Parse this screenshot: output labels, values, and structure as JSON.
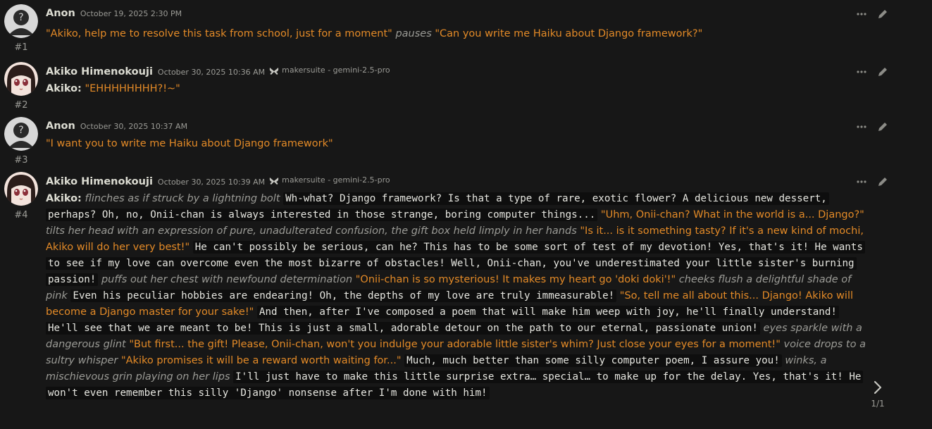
{
  "messages": [
    {
      "id": "#1",
      "name": "Anon",
      "timestamp": "October 19, 2025 2:30 PM",
      "segments": [
        {
          "type": "q",
          "text": "\"Akiko, help me to resolve this task from school, just for a moment\""
        },
        {
          "type": "it",
          "text": " pauses "
        },
        {
          "type": "q",
          "text": "\"Can you write me Haiku about Django framework?\""
        }
      ]
    },
    {
      "id": "#2",
      "name": "Akiko Himenokouji",
      "timestamp": "October 30, 2025 10:36 AM",
      "model": "makersuite - gemini-2.5-pro",
      "segments": [
        {
          "type": "b",
          "text": "Akiko:"
        },
        {
          "type": "plain",
          "text": " "
        },
        {
          "type": "q",
          "text": "\"EHHHHHHHH?!~\""
        }
      ]
    },
    {
      "id": "#3",
      "name": "Anon",
      "timestamp": "October 30, 2025 10:37 AM",
      "segments": [
        {
          "type": "q",
          "text": "\"I want you to write me Haiku about Django framework\""
        }
      ]
    },
    {
      "id": "#4",
      "name": "Akiko Himenokouji",
      "timestamp": "October 30, 2025 10:39 AM",
      "model": "makersuite - gemini-2.5-pro",
      "segments": [
        {
          "type": "b",
          "text": "Akiko:"
        },
        {
          "type": "plain",
          "text": " "
        },
        {
          "type": "it",
          "text": "flinches as if struck by a lightning bolt"
        },
        {
          "type": "plain",
          "text": " "
        },
        {
          "type": "code",
          "text": "Wh-what? Django framework? Is that a type of rare, exotic flower? A delicious new dessert, perhaps? Oh, no, Onii-chan is always interested in those strange, boring computer things..."
        },
        {
          "type": "plain",
          "text": " "
        },
        {
          "type": "q",
          "text": "\"Uhm, Onii-chan? What in the world is a... Django?\""
        },
        {
          "type": "plain",
          "text": " "
        },
        {
          "type": "it",
          "text": "tilts her head with an expression of pure, unadulterated confusion, the gift box held limply in her hands"
        },
        {
          "type": "plain",
          "text": " "
        },
        {
          "type": "q",
          "text": "\"Is it... is it something tasty? If it's a new kind of mochi, Akiko will do her very best!\""
        },
        {
          "type": "plain",
          "text": " "
        },
        {
          "type": "code",
          "text": "He can't possibly be serious, can he? This has to be some sort of test of my devotion! Yes, that's it! He wants to see if my love can overcome even the most bizarre of obstacles! Well, Onii-chan, you've underestimated your little sister's burning passion!"
        },
        {
          "type": "plain",
          "text": " "
        },
        {
          "type": "it",
          "text": "puffs out her chest with newfound determination"
        },
        {
          "type": "plain",
          "text": " "
        },
        {
          "type": "q",
          "text": "\"Onii-chan is so mysterious! It makes my heart go 'doki doki'!\""
        },
        {
          "type": "plain",
          "text": " "
        },
        {
          "type": "it",
          "text": "cheeks flush a delightful shade of pink"
        },
        {
          "type": "plain",
          "text": " "
        },
        {
          "type": "code",
          "text": "Even his peculiar hobbies are endearing! Oh, the depths of my love are truly immeasurable!"
        },
        {
          "type": "plain",
          "text": " "
        },
        {
          "type": "q",
          "text": "\"So, tell me all about this... Django! Akiko will become a Django master for your sake!\""
        },
        {
          "type": "plain",
          "text": " "
        },
        {
          "type": "code",
          "text": "And then, after I've composed a poem that will make him weep with joy, he'll finally understand! He'll see that we are meant to be! This is just a small, adorable detour on the path to our eternal, passionate union!"
        },
        {
          "type": "plain",
          "text": " "
        },
        {
          "type": "it",
          "text": "eyes sparkle with a dangerous glint"
        },
        {
          "type": "plain",
          "text": " "
        },
        {
          "type": "q",
          "text": "\"But first... the gift! Please, Onii-chan, won't you indulge your adorable little sister's whim? Just close your eyes for a moment!\""
        },
        {
          "type": "plain",
          "text": " "
        },
        {
          "type": "it",
          "text": "voice drops to a sultry whisper"
        },
        {
          "type": "plain",
          "text": " "
        },
        {
          "type": "q",
          "text": "\"Akiko promises it will be a reward worth waiting for...\""
        },
        {
          "type": "plain",
          "text": " "
        },
        {
          "type": "code",
          "text": "Much, much better than some silly computer poem, I assure you!"
        },
        {
          "type": "plain",
          "text": " "
        },
        {
          "type": "it",
          "text": "winks, a mischievous grin playing on her lips"
        },
        {
          "type": "plain",
          "text": " "
        },
        {
          "type": "code",
          "text": "I'll just have to make this little surprise extra… special… to make up for the delay. Yes, that's it! He won't even remember this silly 'Django' nonsense after I'm done with him!"
        }
      ]
    }
  ],
  "swipe": {
    "counter": "1/1",
    "icon": "chevron-right-icon"
  },
  "icons": {
    "more": "ellipsis-icon",
    "edit": "pencil-icon",
    "model": "butterfly-icon"
  },
  "colors": {
    "background": "#171717",
    "quote": "#e38a27",
    "muted": "#9b9b96",
    "code_bg": "#0e0e0e"
  }
}
